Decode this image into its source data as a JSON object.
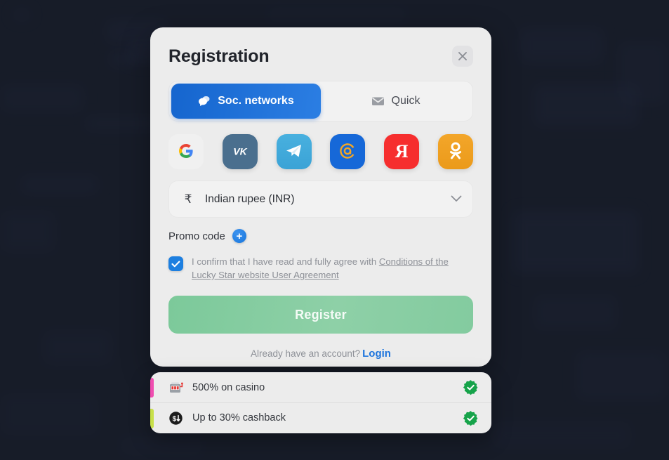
{
  "background": {
    "color": "#171c28"
  },
  "modal": {
    "title": "Registration",
    "close_icon": "close-icon",
    "tabs": [
      {
        "label": "Soc. networks",
        "icon": "chat-bubbles-icon",
        "active": true
      },
      {
        "label": "Quick",
        "icon": "envelope-icon",
        "active": false
      }
    ],
    "socials": [
      {
        "name": "google",
        "letter": "G",
        "color": "#f0f0f0"
      },
      {
        "name": "vk",
        "letter": "VK",
        "color": "#4a6f8e"
      },
      {
        "name": "telegram",
        "letter": "",
        "color": "#48b0df"
      },
      {
        "name": "mailru",
        "letter": "@",
        "color": "#1668d8"
      },
      {
        "name": "yandex",
        "letter": "Я",
        "color": "#f62e2e"
      },
      {
        "name": "odnoklassniki",
        "letter": "OK",
        "color": "#f3a62a"
      }
    ],
    "currency": {
      "symbol": "₹",
      "label": "Indian rupee (INR)",
      "chevron_icon": "chevron-down-icon"
    },
    "promo": {
      "label": "Promo code",
      "add_icon": "plus-icon"
    },
    "agreement": {
      "checked": true,
      "text_plain": "I confirm that I have read and fully agree with ",
      "text_link": "Conditions of the Lucky Star website User Agreement"
    },
    "register_button": {
      "label": "Register",
      "color": "#83cb9f",
      "enabled": false
    },
    "login_row": {
      "prompt": "Already have an account?",
      "link": "Login",
      "link_color": "#1d74dd"
    }
  },
  "bonuses": [
    {
      "icon": "slot-machine-icon",
      "label": "500% on casino",
      "accent": "#ef4db0",
      "status_icon": "verified-check-icon"
    },
    {
      "icon": "cashback-icon",
      "label": "Up to 30% cashback",
      "accent": "#c8e04a",
      "status_icon": "verified-check-icon"
    }
  ]
}
